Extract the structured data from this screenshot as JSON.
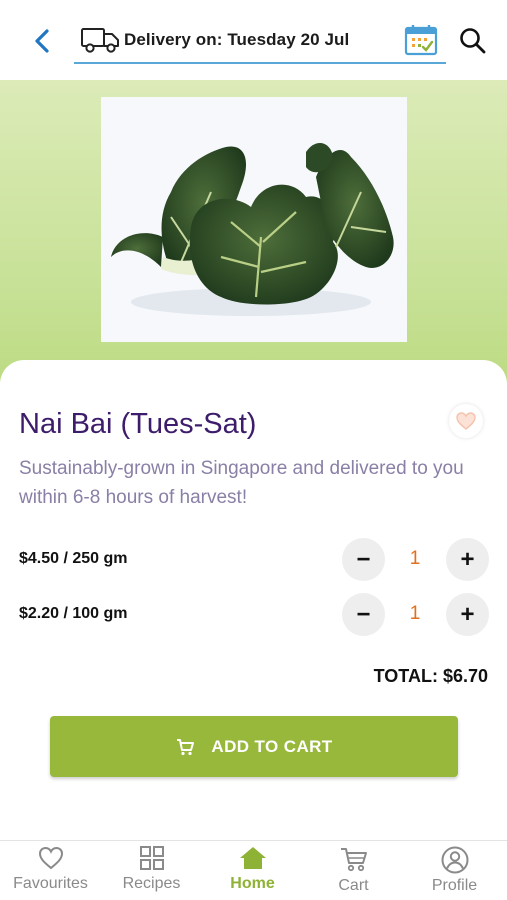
{
  "header": {
    "delivery_text": "Delivery on: Tuesday 20 Jul",
    "icons": [
      "back-arrow-icon",
      "truck-icon",
      "calendar-icon",
      "search-icon"
    ]
  },
  "product": {
    "image": "bok-choy-photo",
    "name": "Nai Bai (Tues-Sat)",
    "description": "Sustainably-grown in Singapore and delivered to you within 6-8 hours of harvest!",
    "options": [
      {
        "price_label": "$4.50 / 250 gm",
        "quantity": "1",
        "minus": "−",
        "plus": "+"
      },
      {
        "price_label": "$2.20 / 100 gm",
        "quantity": "1",
        "minus": "−",
        "plus": "+"
      }
    ],
    "total": "TOTAL: $6.70"
  },
  "actions": {
    "add_to_cart_label": "ADD TO CART"
  },
  "tabbar": {
    "items": [
      {
        "label": "Favourites",
        "icon": "heart-icon",
        "active": false
      },
      {
        "label": "Recipes",
        "icon": "grid-icon",
        "active": false
      },
      {
        "label": "Home",
        "icon": "home-icon",
        "active": true
      },
      {
        "label": "Cart",
        "icon": "cart-icon",
        "active": false
      },
      {
        "label": "Profile",
        "icon": "profile-icon",
        "active": false
      }
    ]
  },
  "colors": {
    "accent_green": "#98b83c",
    "title_purple": "#3d1d6b",
    "qty_orange": "#e0701f",
    "link_blue": "#1f76c2"
  }
}
